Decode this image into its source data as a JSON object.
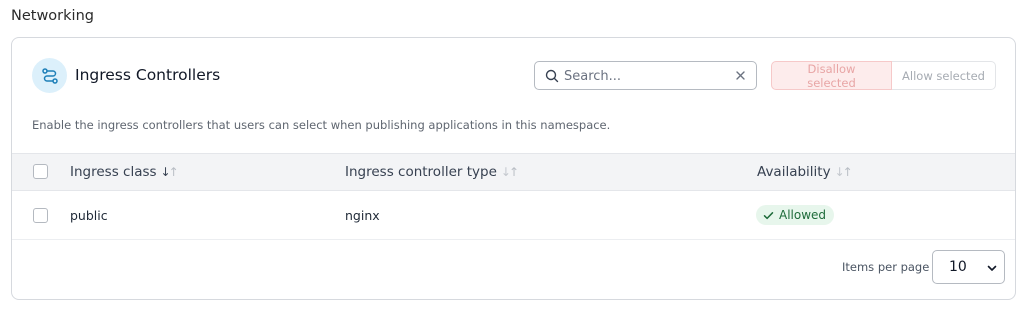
{
  "section": {
    "title": "Networking"
  },
  "card": {
    "title": "Ingress Controllers",
    "icon": "route-icon",
    "description": "Enable the ingress controllers that users can select when publishing applications in this namespace."
  },
  "search": {
    "placeholder": "Search...",
    "value": ""
  },
  "actions": {
    "disallow_label": "Disallow selected",
    "allow_label": "Allow selected"
  },
  "table": {
    "columns": [
      {
        "label": "Ingress class",
        "sort": "descending"
      },
      {
        "label": "Ingress controller type",
        "sort": "none"
      },
      {
        "label": "Availability",
        "sort": "none"
      }
    ],
    "rows": [
      {
        "ingress_class": "public",
        "controller_type": "nginx",
        "availability": "Allowed"
      }
    ]
  },
  "pagination": {
    "label": "Items per page",
    "value": "10"
  },
  "colors": {
    "accent_blue": "#dcf0fb",
    "allowed_green": "#1e6b3a",
    "disallow_red": "#e8a5a5"
  }
}
